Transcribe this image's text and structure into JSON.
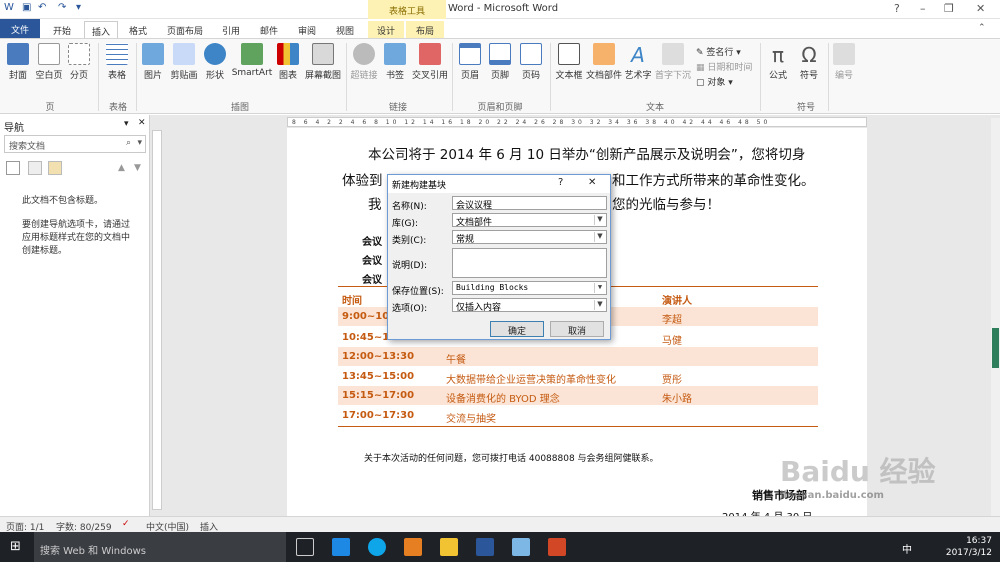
{
  "title_bar": {
    "app_title": "Word - Microsoft Word",
    "context_tab_group": "表格工具",
    "win_controls": [
      "?",
      "–",
      "❐",
      "✕"
    ]
  },
  "tabs": [
    "文件",
    "开始",
    "插入",
    "格式",
    "页面布局",
    "引用",
    "邮件",
    "审阅",
    "视图",
    "设计",
    "布局"
  ],
  "ribbon": {
    "buttons": [
      "封面",
      "空白页",
      "分页",
      "表格",
      "图片",
      "剪贴画",
      "形状",
      "SmartArt",
      "图表",
      "屏幕截图",
      "超链接",
      "书签",
      "交叉引用",
      "页眉",
      "页脚",
      "页码",
      "文本框",
      "文档部件",
      "艺术字",
      "首字下沉",
      "公式",
      "符号",
      "编号"
    ],
    "small_items": [
      "签名行",
      "日期和时间",
      "对象"
    ],
    "groups": [
      "页",
      "表格",
      "插图",
      "链接",
      "页眉和页脚",
      "文本",
      "符号"
    ]
  },
  "nav": {
    "title": "导航",
    "search_placeholder": "搜索文档",
    "msg1": "此文档不包含标题。",
    "msg2": "要创建导航选项卡，请通过应用标题样式在您的文档中创建标题。"
  },
  "ruler": "8 6 4 2 2 4 6 8 10 12 14 16 18 20 22 24 26 28 30 32 34 36 38 40 42 44 46 48 50",
  "document": {
    "line1": "本公司将于 2014 年 6 月 10 日举办“创新产品展示及说明会”，您将切身",
    "line2_a": "体验到",
    "line2_b": "和工作方式所带来的革命性变化。",
    "line3_a": "我",
    "line3_b": "您的光临与参与！",
    "labels": [
      "会议",
      "会议",
      "会议"
    ],
    "table_headers": [
      "时间",
      "演讲人"
    ],
    "rows": [
      {
        "time": "9:00~10",
        "topic": "",
        "speaker": "李超"
      },
      {
        "time": "10:45~1",
        "topic": "",
        "speaker": "马健"
      },
      {
        "time": "12:00~13:30",
        "topic": "午餐",
        "speaker": ""
      },
      {
        "time": "13:45~15:00",
        "topic": "大数据带给企业运营决策的革命性变化",
        "speaker": "贾彤"
      },
      {
        "time": "15:15~17:00",
        "topic": "设备消费化的 BYOD 理念",
        "speaker": "朱小路"
      },
      {
        "time": "17:00~17:30",
        "topic": "交流与抽奖",
        "speaker": ""
      }
    ],
    "footer_note": "关于本次活动的任何问题，您可拨打电话 40088808 与会务组阿健联系。",
    "signature": "销售市场部",
    "date_partial": "2014 年 4 月 30 日"
  },
  "dialog": {
    "title": "新建构建基块",
    "help": "?",
    "close": "✕",
    "fields": [
      {
        "label": "名称(N):",
        "value": "会议议程"
      },
      {
        "label": "库(G):",
        "value": "文档部件"
      },
      {
        "label": "类别(C):",
        "value": "常规"
      },
      {
        "label": "说明(D):",
        "value": ""
      },
      {
        "label": "保存位置(S):",
        "value": "Building Blocks"
      },
      {
        "label": "选项(O):",
        "value": "仅插入内容"
      }
    ],
    "ok": "确定",
    "cancel": "取消"
  },
  "status": {
    "page": "页面: 1/1",
    "words": "字数: 80/259",
    "lang": "中文(中国)",
    "mode": "插入"
  },
  "taskbar": {
    "search": "搜索 Web 和 Windows",
    "time": "16:37",
    "date": "2017/3/12",
    "ime": "中"
  },
  "watermark": "Baidu 经验",
  "watermark_url": "jingyan.baidu.com"
}
